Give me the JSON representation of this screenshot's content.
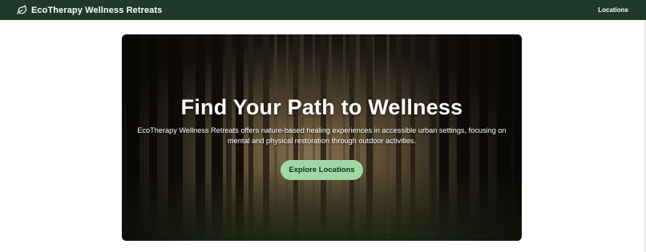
{
  "header": {
    "brand_icon": "leaf-icon",
    "brand_name": "EcoTherapy Wellness Retreats",
    "nav": [
      "Locations"
    ],
    "background": "#1f3a2b"
  },
  "hero": {
    "background_image": "forest-trees-photo",
    "title": "Find Your Path to Wellness",
    "description": "EcoTherapy Wellness Retreats offers nature-based healing experiences in accessible urban settings, focusing on mental and physical restoration through outdoor activities.",
    "cta_label": "Explore Locations",
    "cta_color": "#9ed9a4"
  }
}
